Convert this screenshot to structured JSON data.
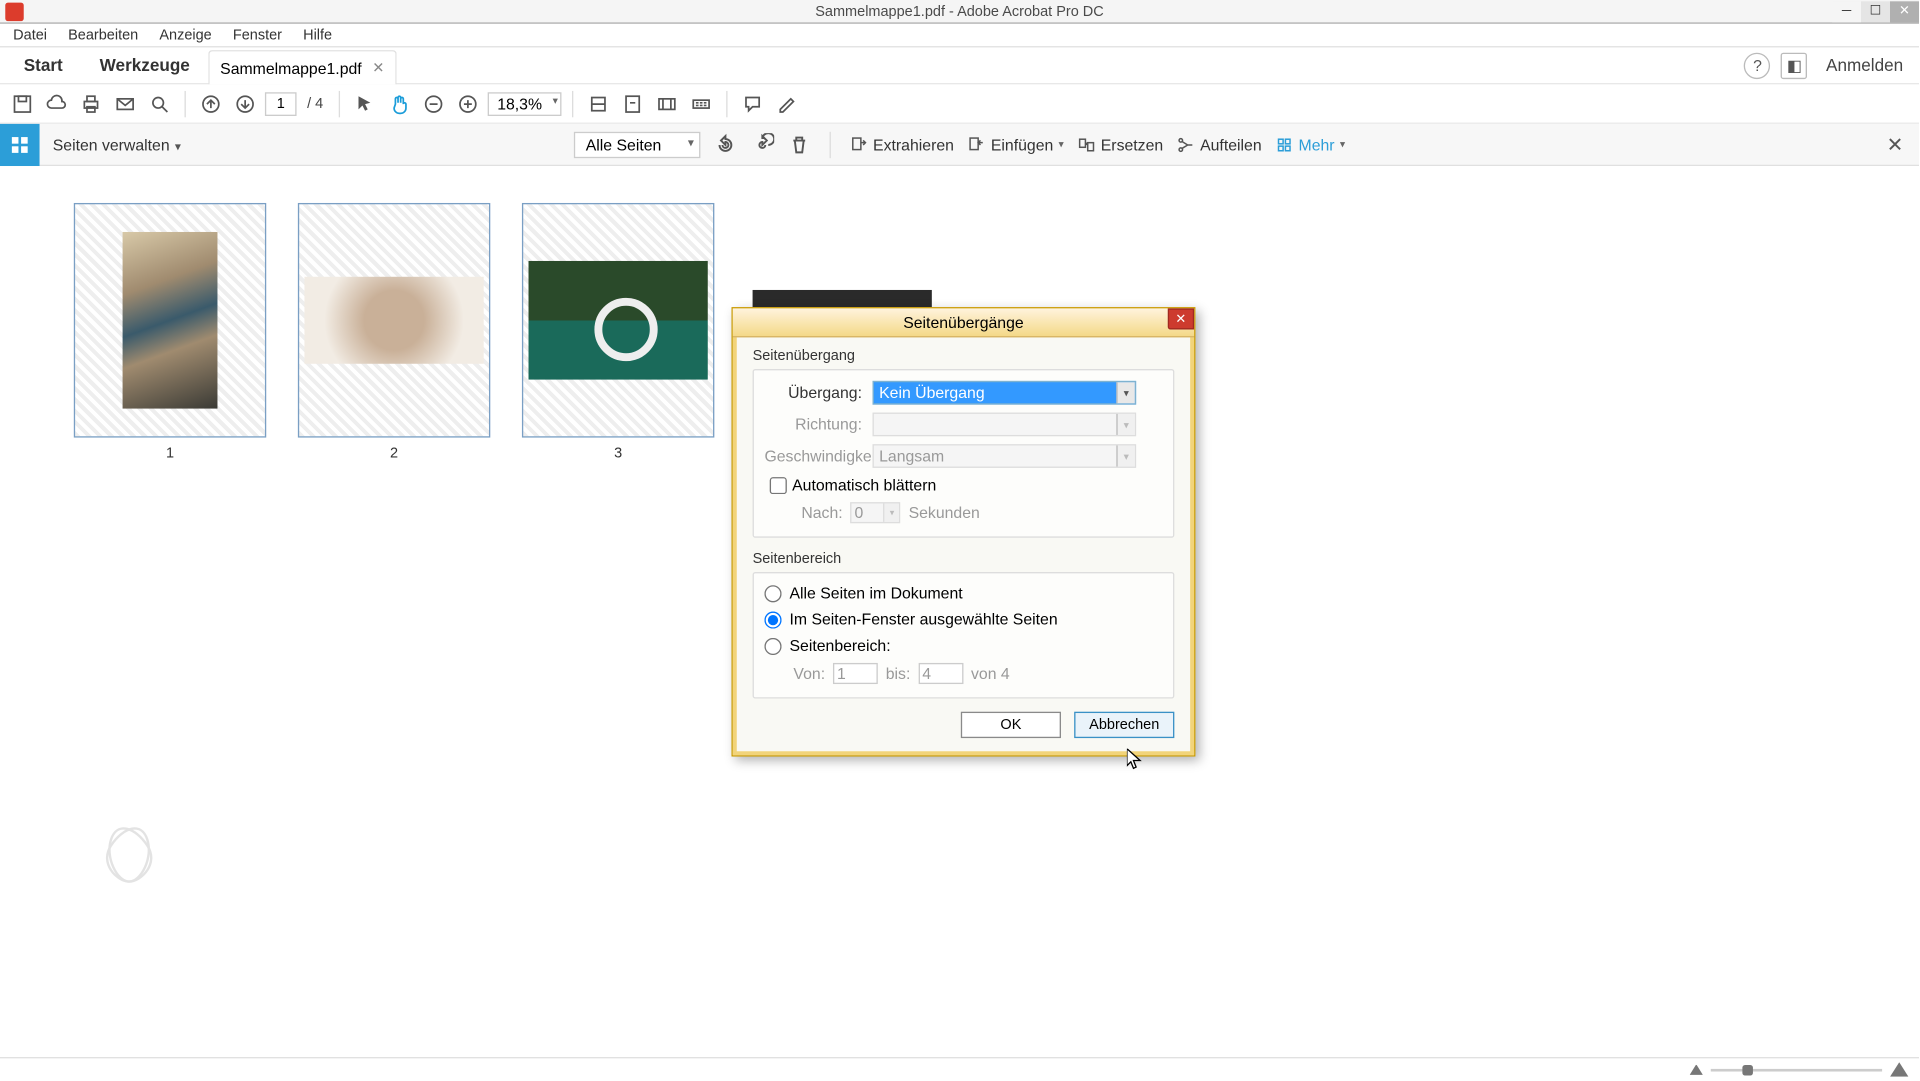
{
  "title": "Sammelmappe1.pdf - Adobe Acrobat Pro DC",
  "menus": [
    "Datei",
    "Bearbeiten",
    "Anzeige",
    "Fenster",
    "Hilfe"
  ],
  "tabs": {
    "start": "Start",
    "tools": "Werkzeuge",
    "doc": "Sammelmappe1.pdf"
  },
  "login": "Anmelden",
  "page": {
    "current": "1",
    "total": "/ 4"
  },
  "zoom": "18,3%",
  "org": {
    "title": "Seiten verwalten",
    "all_pages": "Alle Seiten",
    "extract": "Extrahieren",
    "insert": "Einfügen",
    "replace": "Ersetzen",
    "split": "Aufteilen",
    "more": "Mehr"
  },
  "thumbs": [
    "1",
    "2",
    "3"
  ],
  "dialog": {
    "title": "Seitenübergänge",
    "grp1": "Seitenübergang",
    "lbl_transition": "Übergang:",
    "val_transition": "Kein Übergang",
    "lbl_direction": "Richtung:",
    "lbl_speed": "Geschwindigkeit:",
    "val_speed": "Langsam",
    "auto": "Automatisch blättern",
    "after": "Nach:",
    "after_val": "0",
    "seconds": "Sekunden",
    "grp2": "Seitenbereich",
    "r1": "Alle Seiten im Dokument",
    "r2": "Im Seiten-Fenster ausgewählte Seiten",
    "r3": "Seitenbereich:",
    "from": "Von:",
    "from_val": "1",
    "to": "bis:",
    "to_val": "4",
    "of": "von 4",
    "ok": "OK",
    "cancel": "Abbrechen"
  }
}
